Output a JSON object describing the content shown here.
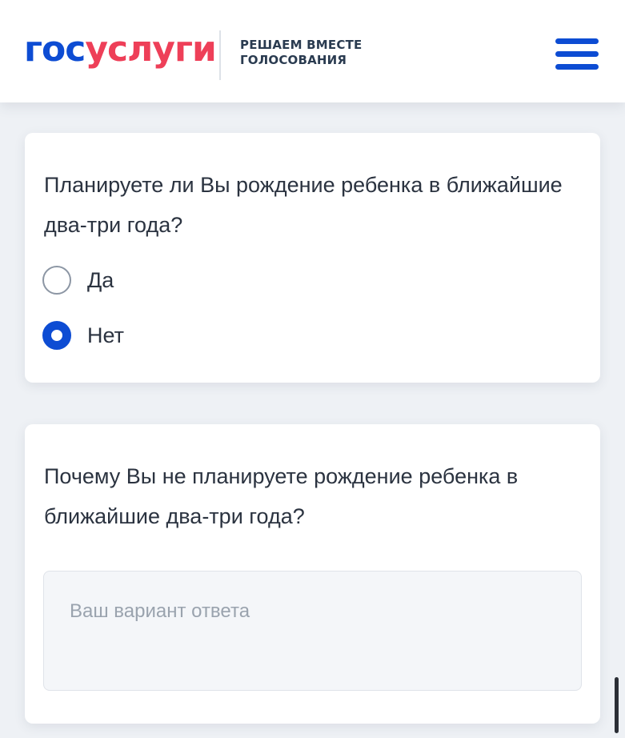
{
  "header": {
    "logo_part_a": "гос",
    "logo_part_b": "услуги",
    "project_line1": "РЕШАЕМ ВМЕСТЕ",
    "project_line2": "ГОЛОСОВАНИЯ",
    "menu_icon": "hamburger-menu-icon"
  },
  "question1": {
    "text": "Планируете ли Вы рождение ребенка в ближайшие два-три года?",
    "options": [
      {
        "label": "Да",
        "selected": false
      },
      {
        "label": "Нет",
        "selected": true
      }
    ]
  },
  "question2": {
    "text": "Почему Вы не планируете рождение ребенка в ближайшие два-три года?",
    "answer_value": "",
    "answer_placeholder": "Ваш вариант ответа"
  },
  "colors": {
    "brand_blue": "#0d4cd3",
    "brand_red": "#ee3f58",
    "text": "#2b3340",
    "background": "#eef1f5"
  }
}
